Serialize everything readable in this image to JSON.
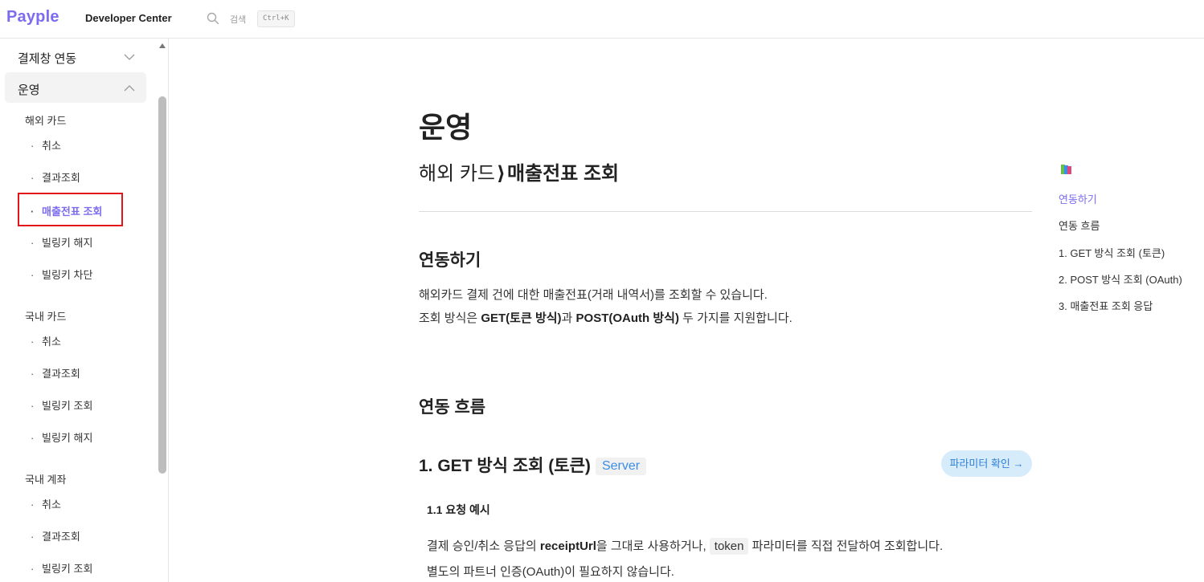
{
  "header": {
    "logo": "Payple",
    "title": "Developer Center",
    "search_label": "검색",
    "shortcut": "Ctrl+K"
  },
  "sidebar": {
    "sections": [
      {
        "label": "결제창 연동",
        "expanded": false
      },
      {
        "label": "운영",
        "expanded": true
      }
    ],
    "groups": [
      {
        "label": "해외 카드",
        "items": [
          "취소",
          "결과조회",
          "매출전표 조회",
          "빌링키 해지",
          "빌링키 차단"
        ]
      },
      {
        "label": "국내 카드",
        "items": [
          "취소",
          "결과조회",
          "빌링키 조회",
          "빌링키 해지"
        ]
      },
      {
        "label": "국내 계좌",
        "items": [
          "취소",
          "결과조회",
          "빌링키 조회"
        ]
      }
    ],
    "current_item": "매출전표 조회"
  },
  "main": {
    "title": "운영",
    "breadcrumb_parent": "해외 카드",
    "breadcrumb_sep": "⟩",
    "breadcrumb_current": "매출전표 조회",
    "section1_title": "연동하기",
    "intro_line1": "해외카드 결제 건에 대한 매출전표(거래 내역서)를 조회할 수 있습니다.",
    "intro_line2_a": "조회 방식은 ",
    "intro_line2_b": "GET(토큰 방식)",
    "intro_line2_c": "과 ",
    "intro_line2_d": "POST(OAuth 방식)",
    "intro_line2_e": " 두 가지를 지원합니다.",
    "section2_title": "연동 흐름",
    "section3_title": "1. GET 방식 조회 (토큰)",
    "server_badge": "Server",
    "param_button": "파라미터 확인 →",
    "subsection_title": "1.1 요청 예시",
    "req_line1_a": "결제 승인/취소 응답의 ",
    "req_line1_b": "receiptUrl",
    "req_line1_c": "을 그대로 사용하거나, ",
    "req_line1_code": "token",
    "req_line1_d": " 파라미터를 직접 전달하여 조회합니다.",
    "req_line2": "별도의 파트너 인증(OAuth)이 필요하지 않습니다."
  },
  "toc": {
    "items": [
      "연동하기",
      "연동 흐름",
      "1. GET 방식 조회 (토큰)",
      "2. POST 방식 조회 (OAuth)",
      "3. 매출전표 조회 응답"
    ],
    "active_index": 0
  },
  "colors": {
    "brand": "#7b6cf0",
    "highlight_border": "#e0161b",
    "server_badge_text": "#3a8ee6",
    "param_button_bg": "#d6ecfb"
  }
}
